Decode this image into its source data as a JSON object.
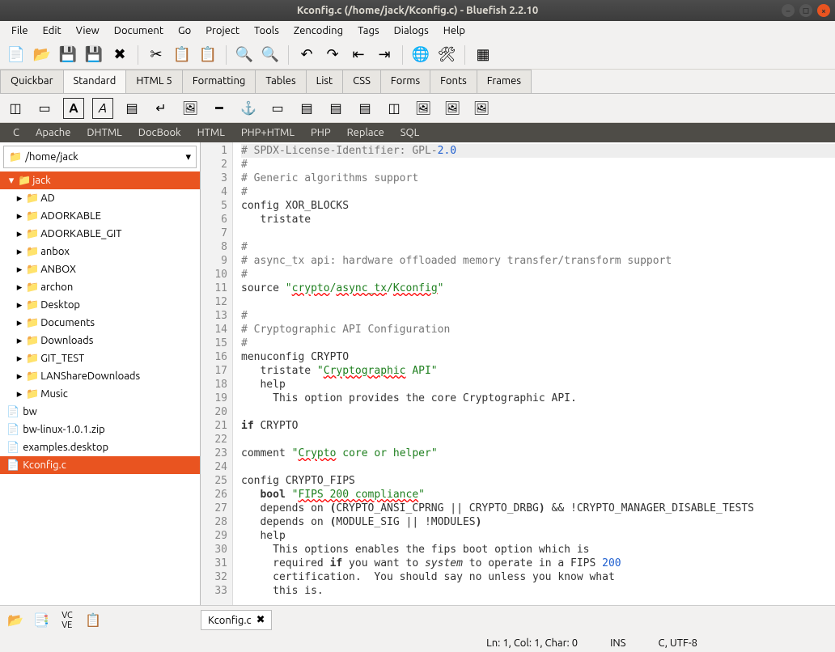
{
  "window": {
    "title": "Kconfig.c (/home/jack/Kconfig.c) - Bluefish 2.2.10"
  },
  "menu": [
    "File",
    "Edit",
    "View",
    "Document",
    "Go",
    "Project",
    "Tools",
    "Zencoding",
    "Tags",
    "Dialogs",
    "Help"
  ],
  "toolbar_tabs": [
    "Quickbar",
    "Standard",
    "HTML 5",
    "Formatting",
    "Tables",
    "List",
    "CSS",
    "Forms",
    "Fonts",
    "Frames"
  ],
  "toolbar_active_tab": 1,
  "langbar": [
    "C",
    "Apache",
    "DHTML",
    "DocBook",
    "HTML",
    "PHP+HTML",
    "PHP",
    "Replace",
    "SQL"
  ],
  "sidebar": {
    "path": "/home/jack",
    "root": "jack",
    "folders": [
      "AD",
      "ADORKABLE",
      "ADORKABLE_GIT",
      "anbox",
      "ANBOX",
      "archon",
      "Desktop",
      "Documents",
      "Downloads",
      "GIT_TEST",
      "LANShareDownloads",
      "Music"
    ],
    "files": [
      "bw",
      "bw-linux-1.0.1.zip",
      "examples.desktop",
      "Kconfig.c"
    ],
    "selected_file": "Kconfig.c"
  },
  "open_tabs": [
    "Kconfig.c"
  ],
  "editor": {
    "line_count": 33,
    "lines": [
      {
        "n": 1,
        "html": "<span class='c-comm'># SPDX-License-Identifier: GPL-</span><span class='c-num'>2.0</span>",
        "hl": true
      },
      {
        "n": 2,
        "html": "<span class='c-comm'>#</span>"
      },
      {
        "n": 3,
        "html": "<span class='c-comm'># Generic algorithms support</span>"
      },
      {
        "n": 4,
        "html": "<span class='c-comm'>#</span>"
      },
      {
        "n": 5,
        "html": "config XOR_BLOCKS"
      },
      {
        "n": 6,
        "html": "   tristate"
      },
      {
        "n": 7,
        "html": ""
      },
      {
        "n": 8,
        "html": "<span class='c-comm'>#</span>"
      },
      {
        "n": 9,
        "html": "<span class='c-comm'># async_tx api: hardware offloaded memory transfer/transform support</span>"
      },
      {
        "n": 10,
        "html": "<span class='c-comm'>#</span>"
      },
      {
        "n": 11,
        "html": "source <span class='c-str'>\"</span><span class='c-err'>crypto</span><span class='c-str'>/</span><span class='c-err'>async_tx</span><span class='c-str'>/</span><span class='c-err'>Kconfig</span><span class='c-str'>\"</span>"
      },
      {
        "n": 12,
        "html": ""
      },
      {
        "n": 13,
        "html": "<span class='c-comm'>#</span>"
      },
      {
        "n": 14,
        "html": "<span class='c-comm'># Cryptographic API Configuration</span>"
      },
      {
        "n": 15,
        "html": "<span class='c-comm'>#</span>"
      },
      {
        "n": 16,
        "html": "menuconfig CRYPTO"
      },
      {
        "n": 17,
        "html": "   tristate <span class='c-str'>\"</span><span class='c-err'>Cryptographic</span><span class='c-str'> API\"</span>"
      },
      {
        "n": 18,
        "html": "   help"
      },
      {
        "n": 19,
        "html": "     This option provides the core Cryptographic API."
      },
      {
        "n": 20,
        "html": ""
      },
      {
        "n": 21,
        "html": "<span class='c-kw'>if</span> CRYPTO"
      },
      {
        "n": 22,
        "html": ""
      },
      {
        "n": 23,
        "html": "comment <span class='c-str'>\"</span><span class='c-err'>Crypto</span><span class='c-str'> core or helper\"</span>"
      },
      {
        "n": 24,
        "html": ""
      },
      {
        "n": 25,
        "html": "config CRYPTO_FIPS"
      },
      {
        "n": 26,
        "html": "   <span class='c-kw'>bool</span> <span class='c-str'>\"</span><span class='c-err'>FIPS 200 compliance</span><span class='c-str'>\"</span>"
      },
      {
        "n": 27,
        "html": "   depends on <span class='c-kw'>(</span>CRYPTO_ANSI_CPRNG || CRYPTO_DRBG<span class='c-kw'>)</span> && !CRYPTO_MANAGER_DISABLE_TESTS"
      },
      {
        "n": 28,
        "html": "   depends on <span class='c-kw'>(</span>MODULE_SIG || !MODULES<span class='c-kw'>)</span>"
      },
      {
        "n": 29,
        "html": "   help"
      },
      {
        "n": 30,
        "html": "     This options enables the fips boot option which is"
      },
      {
        "n": 31,
        "html": "     required <span class='c-kw'>if</span> you want to <span class='c-lit'>system</span> to operate in a FIPS <span class='c-num'>200</span>"
      },
      {
        "n": 32,
        "html": "     certification.  You should say no unless you know what"
      },
      {
        "n": 33,
        "html": "     this is."
      }
    ]
  },
  "status": {
    "pos": "Ln: 1, Col: 1, Char: 0",
    "ins": "INS",
    "enc": "C, UTF-8"
  }
}
